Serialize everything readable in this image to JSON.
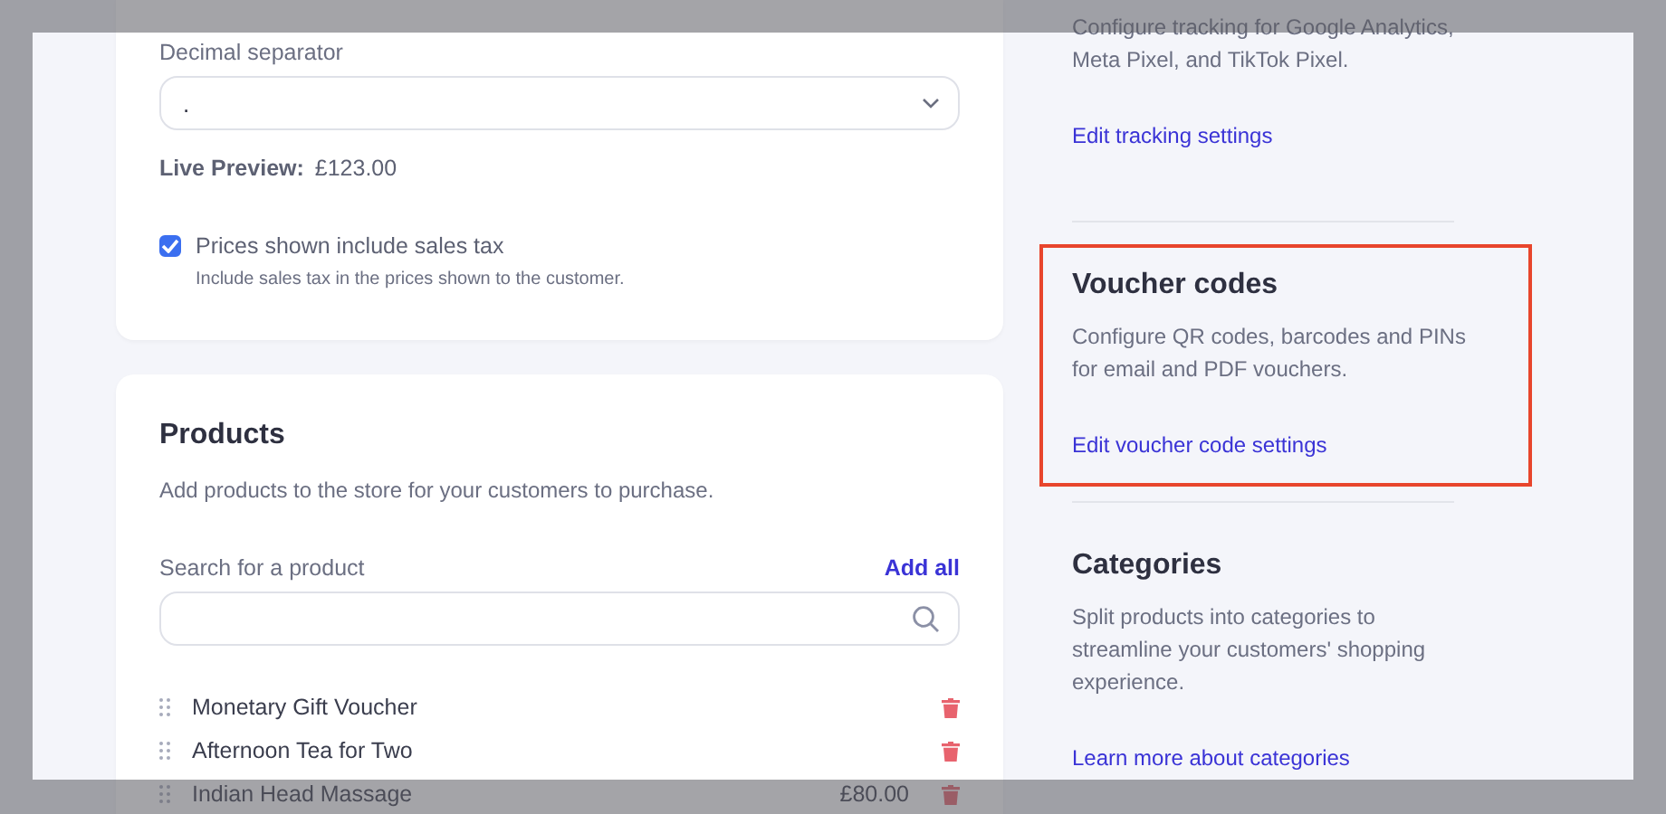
{
  "currency_card": {
    "separator_label": "Decimal separator",
    "separator_value": ".",
    "preview_label": "Live Preview:",
    "preview_value": "£123.00",
    "tax_option": {
      "label": "Prices shown include sales tax",
      "hint": "Include sales tax in the prices shown to the customer.",
      "checked": true
    }
  },
  "products_card": {
    "title": "Products",
    "description": "Add products to the store for your customers to purchase.",
    "search_label": "Search for a product",
    "add_all": "Add all",
    "products": [
      {
        "name": "Monetary Gift Voucher"
      },
      {
        "name": "Afternoon Tea for Two"
      },
      {
        "name": "Indian Head Massage",
        "price": "£80.00"
      }
    ]
  },
  "sections": [
    {
      "description": "Configure tracking for Google Analytics, Meta Pixel, and TikTok Pixel.",
      "link": "Edit tracking settings",
      "highlighted": false
    },
    {
      "title": "Voucher codes",
      "description": "Configure QR codes, barcodes and PINs for email and PDF vouchers.",
      "link": "Edit voucher code settings",
      "highlighted": true
    },
    {
      "title": "Categories",
      "description": "Split products into categories to streamline your customers' shopping experience.",
      "link": "Learn more about categories",
      "highlighted": false
    }
  ]
}
